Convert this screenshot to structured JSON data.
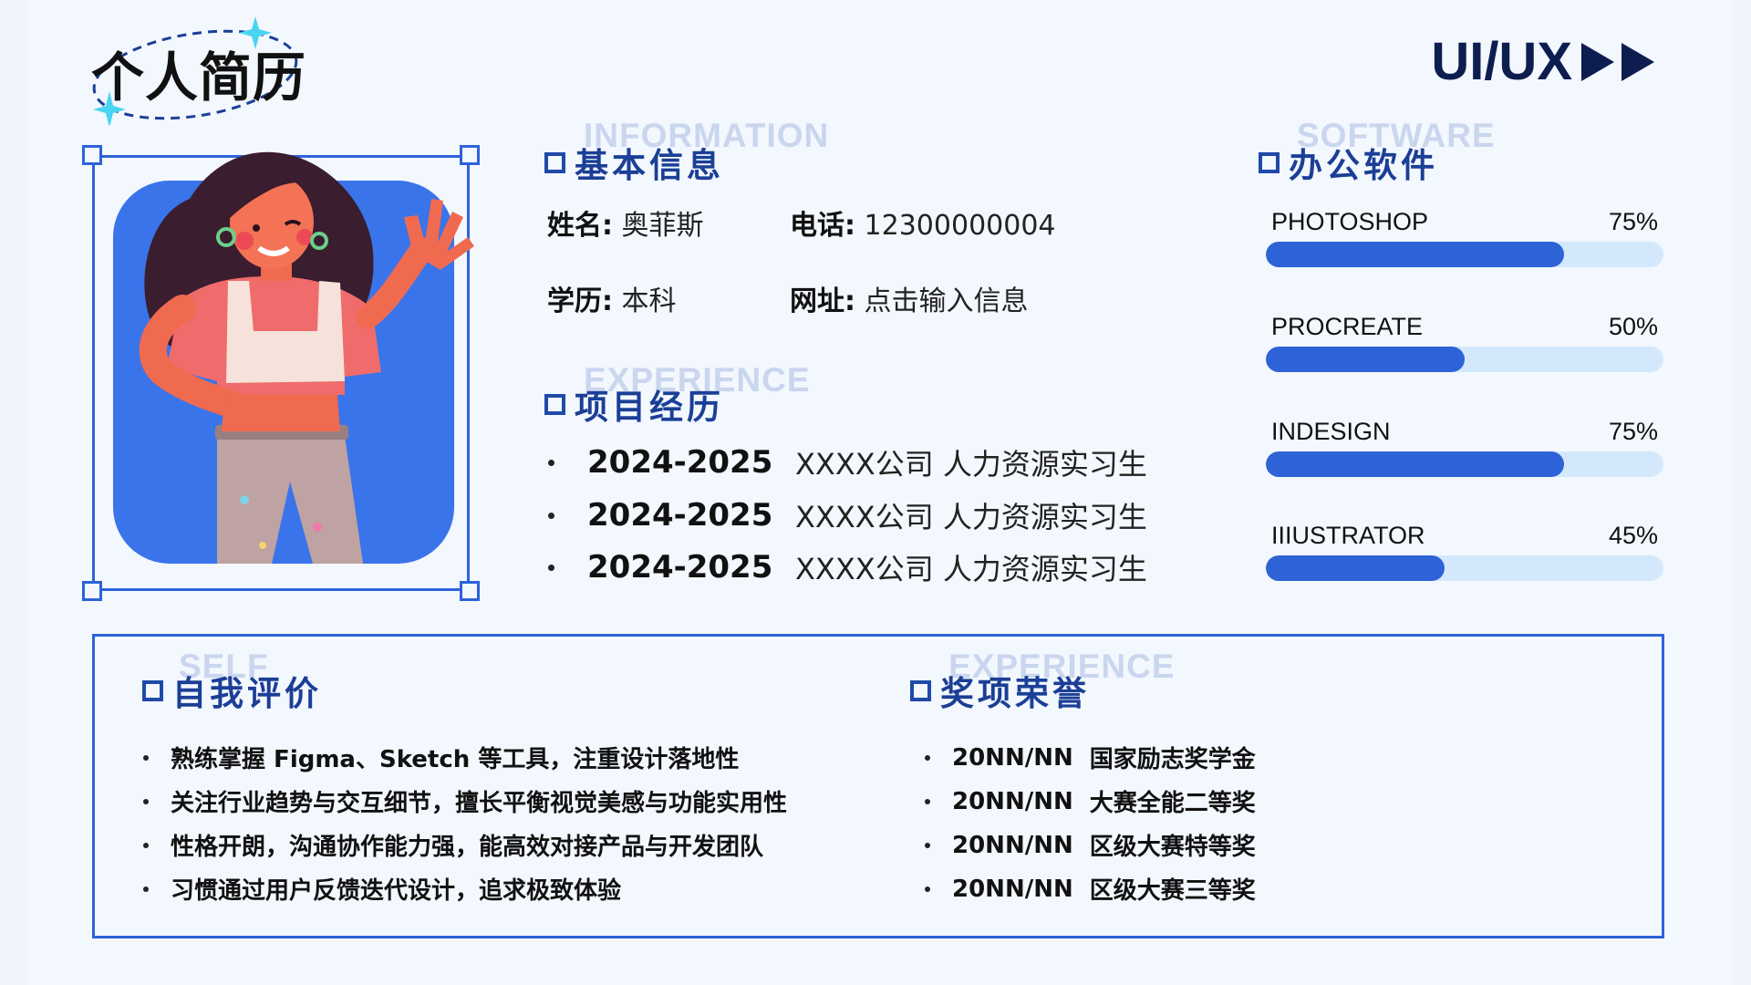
{
  "header": {
    "title": "个人简历",
    "brand": "UI/UX"
  },
  "colors": {
    "accent": "#2d63d9",
    "heading": "#1b3f96",
    "bar_fill": "#2e63d8",
    "bar_track": "#d3e9fb"
  },
  "photo": {
    "icon": "illustrated-woman-avatar"
  },
  "basic_info": {
    "title": "基本信息",
    "ghost": "INFORMATION",
    "name_label": "姓名:",
    "name_value": "奥菲斯",
    "phone_label": "电话:",
    "phone_value": "12300000004",
    "edu_label": "学历:",
    "edu_value": "本科",
    "site_label": "网址:",
    "site_value": "点击输入信息"
  },
  "projects": {
    "title": "项目经历",
    "ghost": "EXPERIENCE",
    "items": [
      {
        "year": "2024-2025",
        "desc": "XXXX公司 人力资源实习生"
      },
      {
        "year": "2024-2025",
        "desc": "XXXX公司 人力资源实习生"
      },
      {
        "year": "2024-2025",
        "desc": "XXXX公司 人力资源实习生"
      }
    ]
  },
  "software": {
    "title": "办公软件",
    "ghost": "SOFTWARE",
    "items": [
      {
        "name": "PHOTOSHOP",
        "percent_label": "75%",
        "value": 0.75
      },
      {
        "name": "PROCREATE",
        "percent_label": "50%",
        "value": 0.5
      },
      {
        "name": "INDESIGN",
        "percent_label": "75%",
        "value": 0.75
      },
      {
        "name": "IIIUSTRATOR",
        "percent_label": "45%",
        "value": 0.45
      }
    ]
  },
  "self_eval": {
    "title": "自我评价",
    "ghost": "SELF",
    "items": [
      "熟练掌握 Figma、Sketch 等工具，注重设计落地性",
      "关注行业趋势与交互细节，擅长平衡视觉美感与功能实用性",
      "性格开朗，沟通协作能力强，能高效对接产品与开发团队",
      "习惯通过用户反馈迭代设计，追求极致体验"
    ]
  },
  "awards": {
    "title": "奖项荣誉",
    "ghost": "EXPERIENCE",
    "items": [
      {
        "date": "20NN/NN",
        "name": "国家励志奖学金"
      },
      {
        "date": "20NN/NN",
        "name": "大赛全能二等奖"
      },
      {
        "date": "20NN/NN",
        "name": "区级大赛特等奖"
      },
      {
        "date": "20NN/NN",
        "name": "区级大赛三等奖"
      }
    ]
  }
}
